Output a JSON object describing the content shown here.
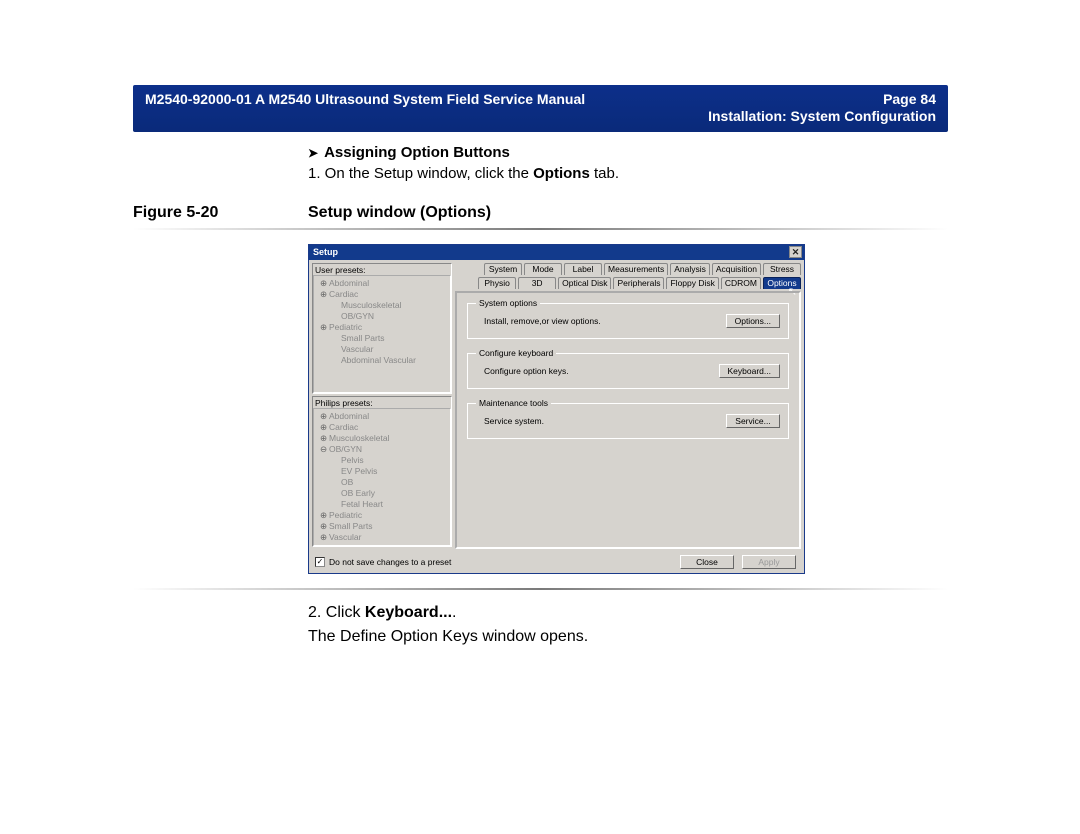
{
  "header": {
    "doc_title": "M2540-92000-01 A M2540 Ultrasound System Field Service Manual",
    "page_label": "Page 84",
    "section": "Installation: System Configuration"
  },
  "section": {
    "heading": "Assigning Option Buttons",
    "step1_prefix": "1.  On the Setup window, click the ",
    "step1_bold": "Options",
    "step1_suffix": " tab."
  },
  "figure": {
    "label": "Figure 5-20",
    "caption": "Setup window (Options)"
  },
  "setup": {
    "title": "Setup",
    "user_presets_label": "User presets:",
    "philips_presets_label": "Philips presets:",
    "user_presets": [
      {
        "g": "⊕",
        "t": "Abdominal"
      },
      {
        "g": "⊕",
        "t": "Cardiac"
      },
      {
        "g": " ",
        "t": "Musculoskeletal",
        "indent": 1
      },
      {
        "g": " ",
        "t": "OB/GYN",
        "indent": 1
      },
      {
        "g": "⊕",
        "t": "Pediatric"
      },
      {
        "g": " ",
        "t": "Small Parts",
        "indent": 1
      },
      {
        "g": " ",
        "t": "Vascular",
        "indent": 1
      },
      {
        "g": " ",
        "t": "Abdominal Vascular",
        "indent": 1
      }
    ],
    "philips_presets": [
      {
        "g": "⊕",
        "t": "Abdominal"
      },
      {
        "g": "⊕",
        "t": "Cardiac"
      },
      {
        "g": "⊕",
        "t": "Musculoskeletal"
      },
      {
        "g": "⊖",
        "t": "OB/GYN"
      },
      {
        "g": " ",
        "t": "Pelvis",
        "indent": 1
      },
      {
        "g": " ",
        "t": "EV Pelvis",
        "indent": 1
      },
      {
        "g": " ",
        "t": "OB",
        "indent": 1
      },
      {
        "g": " ",
        "t": "OB Early",
        "indent": 1
      },
      {
        "g": " ",
        "t": "Fetal Heart",
        "indent": 1
      },
      {
        "g": "⊕",
        "t": "Pediatric"
      },
      {
        "g": "⊕",
        "t": "Small Parts"
      },
      {
        "g": "⊕",
        "t": "Vascular"
      }
    ],
    "tabs_row1": [
      "System",
      "Mode",
      "Label",
      "Measurements",
      "Analysis",
      "Acquisition",
      "Stress"
    ],
    "tabs_row2": [
      "Physio",
      "3D",
      "Optical Disk",
      "Peripherals",
      "Floppy Disk",
      "CDROM",
      "Options"
    ],
    "groups": {
      "system_options": {
        "legend": "System options",
        "text": "Install, remove,or view options.",
        "button": "Options..."
      },
      "configure_keyboard": {
        "legend": "Configure keyboard",
        "text": "Configure option keys.",
        "button": "Keyboard..."
      },
      "maintenance_tools": {
        "legend": "Maintenance tools",
        "text": "Service system.",
        "button": "Service..."
      }
    },
    "checkbox_label": "Do not save changes to a preset",
    "close_btn": "Close",
    "apply_btn": "Apply"
  },
  "after": {
    "step2_prefix": "2.  Click ",
    "step2_bold": "Keyboard...",
    "step2_suffix": ".",
    "step2_result": "The Define Option Keys window opens."
  }
}
